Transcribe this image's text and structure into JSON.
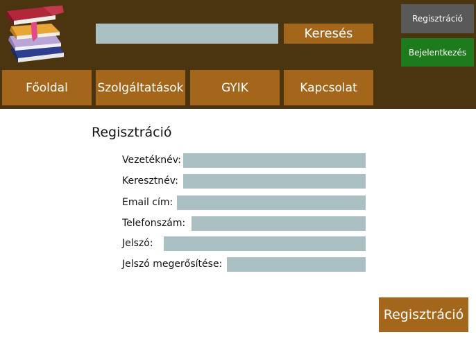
{
  "header": {
    "logo_icon": "books-stack-icon",
    "search": {
      "value": "",
      "placeholder": "",
      "button_label": "Keresés"
    },
    "register_label": "Regisztráció",
    "login_label": "Bejelentkezés"
  },
  "nav": {
    "items": [
      {
        "label": "Főoldal"
      },
      {
        "label": "Szolgáltatások"
      },
      {
        "label": "GYIK"
      },
      {
        "label": "Kapcsolat"
      }
    ]
  },
  "form": {
    "title": "Regisztráció",
    "fields": [
      {
        "label": "Vezetéknév:",
        "value": ""
      },
      {
        "label": "Keresztnév:",
        "value": ""
      },
      {
        "label": "Email cím:",
        "value": ""
      },
      {
        "label": "Telefonszám:",
        "value": ""
      },
      {
        "label": "Jelszó:",
        "value": ""
      },
      {
        "label": "Jelszó megerősítése:",
        "value": ""
      }
    ],
    "submit_label": "Regisztráció"
  },
  "colors": {
    "header_bg": "#4a3510",
    "button_brown": "#a3661b",
    "input_bg": "#a9bfc1",
    "register_gray": "#595959",
    "login_green": "#1d7a1d"
  }
}
